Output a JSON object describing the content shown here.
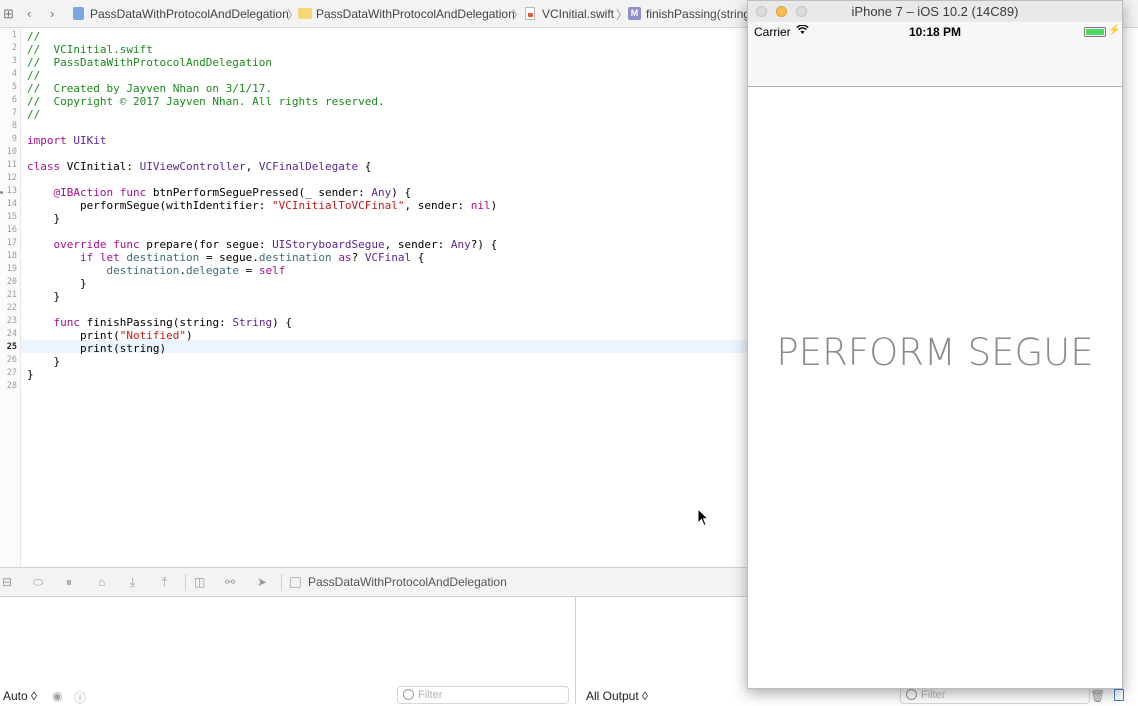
{
  "jump_bar": {
    "crumbs": [
      "PassDataWithProtocolAndDelegation",
      "PassDataWithProtocolAndDelegation",
      "VCInitial.swift",
      "finishPassing(string"
    ]
  },
  "editor": {
    "current_line": 25,
    "lines": [
      "//",
      "//  VCInitial.swift",
      "//  PassDataWithProtocolAndDelegation",
      "//",
      "//  Created by Jayven Nhan on 3/1/17.",
      "//  Copyright © 2017 Jayven Nhan. All rights reserved.",
      "//",
      "",
      "import UIKit",
      "",
      "class VCInitial: UIViewController, VCFinalDelegate {",
      "",
      "    @IBAction func btnPerformSeguePressed(_ sender: Any) {",
      "        performSegue(withIdentifier: \"VCInitialToVCFinal\", sender: nil)",
      "    }",
      "",
      "    override func prepare(for segue: UIStoryboardSegue, sender: Any?) {",
      "        if let destination = segue.destination as? VCFinal {",
      "            destination.delegate = self",
      "        }",
      "    }",
      "",
      "    func finishPassing(string: String) {",
      "        print(\"Notified\")",
      "        print(string)",
      "    }",
      "}",
      ""
    ]
  },
  "debug_bar": {
    "target": "PassDataWithProtocolAndDelegation"
  },
  "debug_area": {
    "variables_mode": "Auto ◊",
    "filter_placeholder": "Filter",
    "output_mode": "All Output ◊"
  },
  "simulator": {
    "title": "iPhone 7 – iOS 10.2 (14C89)",
    "carrier": "Carrier",
    "time": "10:18 PM",
    "battery_level": 1.0,
    "button_label": "PERFORM SEGUE",
    "colors": {
      "battery": "#4cd964",
      "button_text": "#8b8b8b"
    }
  }
}
